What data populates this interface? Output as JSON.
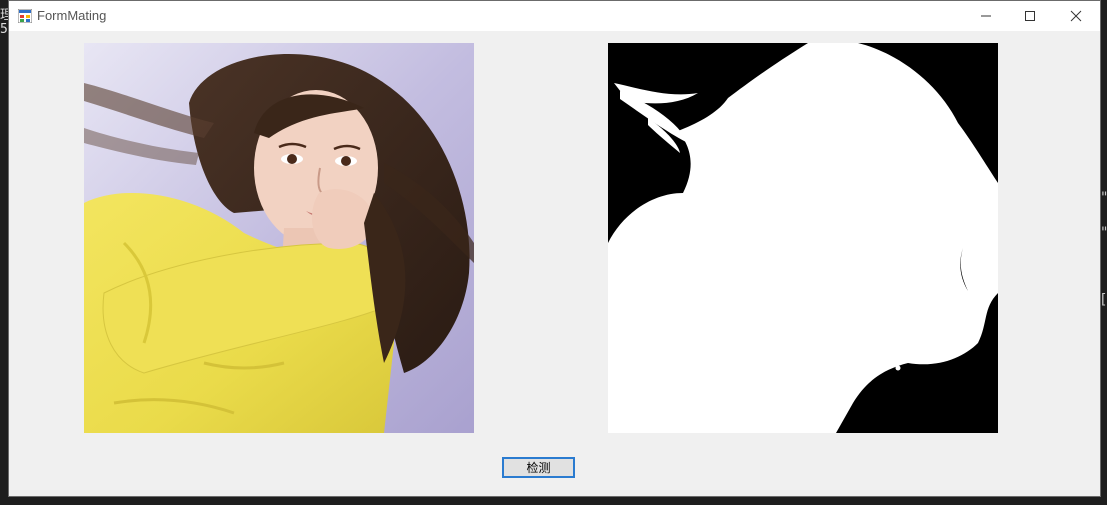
{
  "window": {
    "title": "FormMating"
  },
  "controls": {
    "minimize_icon": "minimize-icon",
    "maximize_icon": "maximize-icon",
    "close_icon": "close-icon"
  },
  "pictures": {
    "source_icon": "photo-portrait",
    "mask_icon": "matting-mask"
  },
  "buttons": {
    "detect_label": "检测"
  },
  "colors": {
    "button_border": "#2a7bd0",
    "window_bg": "#f0f0f0",
    "mask_bg": "#000000",
    "mask_fg": "#ffffff"
  }
}
